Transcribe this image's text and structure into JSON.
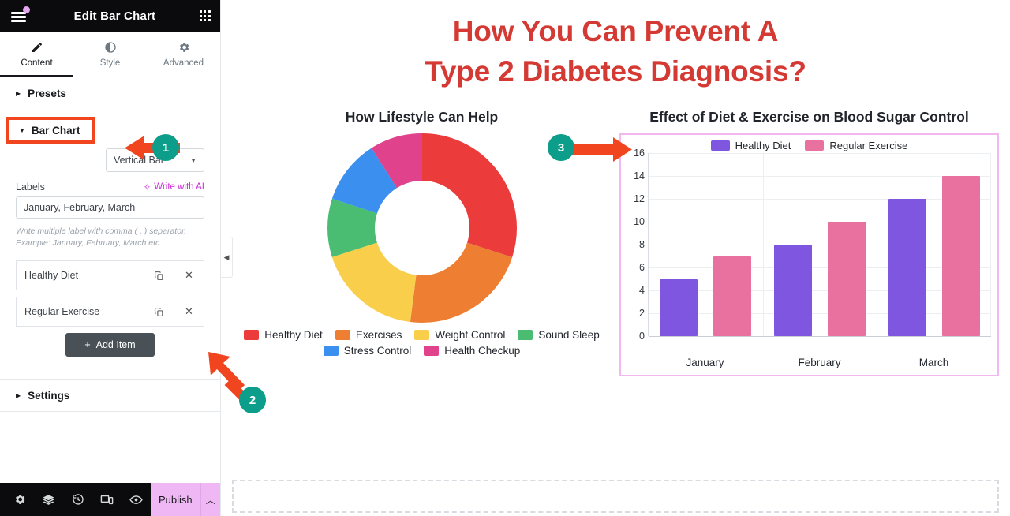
{
  "panel": {
    "title": "Edit Bar Chart",
    "menu_icon": "hamburger-icon",
    "grid_icon": "apps-grid-icon",
    "tabs": [
      {
        "label": "Content",
        "icon": "pencil-icon",
        "active": true
      },
      {
        "label": "Style",
        "icon": "contrast-icon",
        "active": false
      },
      {
        "label": "Advanced",
        "icon": "gear-icon",
        "active": false
      }
    ],
    "sections": {
      "presets": "Presets",
      "bar_chart": "Bar Chart",
      "settings": "Settings"
    },
    "chart_type_select": {
      "value": "Vertical Bar"
    },
    "labels_field": {
      "label": "Labels",
      "ai_link": "Write with AI",
      "value": "January, February, March",
      "hint_line1": "Write multiple label with comma ( , ) separator.",
      "hint_line2": "Example: January, February, March etc"
    },
    "items": [
      {
        "name": "Healthy Diet",
        "duplicate_icon": "copy-icon",
        "remove_icon": "close-icon"
      },
      {
        "name": "Regular Exercise",
        "duplicate_icon": "copy-icon",
        "remove_icon": "close-icon"
      }
    ],
    "add_item_button": "Add Item",
    "footer": {
      "icons": [
        "gear-icon",
        "layers-icon",
        "history-icon",
        "responsive-icon",
        "preview-eye-icon"
      ],
      "publish_label": "Publish",
      "publish_caret": "chevron-up-icon"
    },
    "collapse_handle": "chevron-left-icon"
  },
  "canvas": {
    "heading_line1": "How You Can Prevent A",
    "heading_line2": "Type 2 Diabetes Diagnosis?",
    "heading_color": "#d43a33"
  },
  "callouts": [
    {
      "number": "1"
    },
    {
      "number": "2"
    },
    {
      "number": "3"
    }
  ],
  "chart_data": [
    {
      "type": "pie",
      "title": "How Lifestyle Can Help",
      "variant": "donut",
      "legend_position": "bottom",
      "labels": [
        "Healthy Diet",
        "Exercises",
        "Weight Control",
        "Sound Sleep",
        "Stress Control",
        "Health Checkup"
      ],
      "values": [
        30,
        22,
        18,
        10,
        11,
        9
      ],
      "colors": [
        "#eb3b3b",
        "#ee7f32",
        "#f9ce4b",
        "#4abd72",
        "#3a8fef",
        "#e0428c"
      ]
    },
    {
      "type": "bar",
      "title": "Effect of Diet & Exercise on Blood Sugar Control",
      "categories": [
        "January",
        "February",
        "March"
      ],
      "series": [
        {
          "name": "Healthy Diet",
          "values": [
            5,
            8,
            12
          ],
          "color": "#7f56e0"
        },
        {
          "name": "Regular Exercise",
          "values": [
            7,
            10,
            14
          ],
          "color": "#e8719f"
        }
      ],
      "ylim": [
        0,
        16
      ],
      "yticks": [
        0,
        2,
        4,
        6,
        8,
        10,
        12,
        14,
        16
      ],
      "xlabel": "",
      "ylabel": "",
      "grid": true,
      "legend_position": "top",
      "selection_border_color": "#f2b8f0"
    }
  ]
}
